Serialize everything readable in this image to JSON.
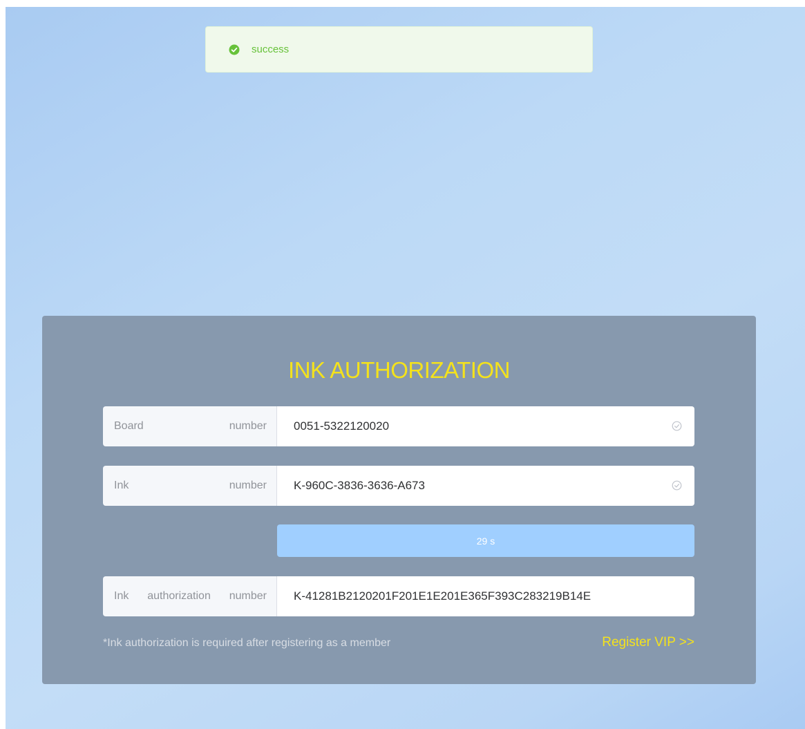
{
  "colors": {
    "accent_yellow": "#f4e21c",
    "success_green": "#67c23a",
    "panel_bg": "#8799ae",
    "countdown_bg": "#a0cfff"
  },
  "toast": {
    "icon": "success-check-circle-icon",
    "text": "success"
  },
  "form": {
    "title": "INK AUTHORIZATION",
    "board": {
      "label_left": "Board",
      "label_right": "number",
      "value": "0051-5322120020",
      "status_icon": "valid-check-icon"
    },
    "ink": {
      "label_left": "Ink",
      "label_right": "number",
      "value": "K-960C-3836-3636-A673",
      "status_icon": "valid-check-icon"
    },
    "countdown": "29 s",
    "authorization": {
      "label_1": "Ink",
      "label_2": "authorization",
      "label_3": "number",
      "value": "K-41281B2120201F201E1E201E365F393C283219B14E"
    },
    "note": "*Ink authorization is required after registering as a member",
    "register_link": "Register VIP >>"
  }
}
